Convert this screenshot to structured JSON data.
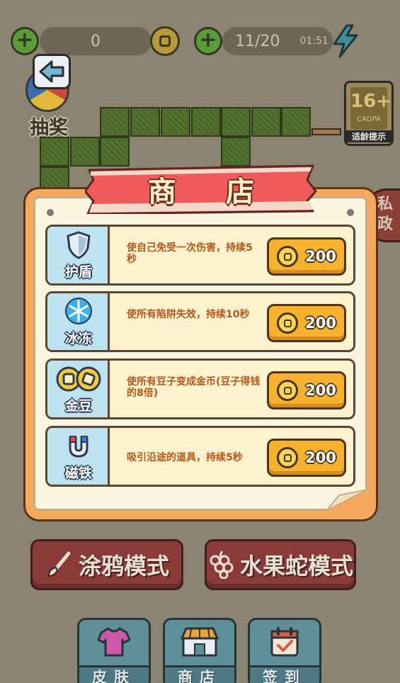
{
  "top_bar": {
    "score": "0",
    "progress": "11/20",
    "timer": "01:51"
  },
  "lottery": {
    "label": "抽奖"
  },
  "age_rating": {
    "label": "16+",
    "org": "CADPA",
    "hint": "适龄提示"
  },
  "side_tab": {
    "label": "私\n政"
  },
  "shop": {
    "title_1": "商",
    "title_2": "店",
    "items": [
      {
        "name": "护盾",
        "icon": "shield-icon",
        "desc": "使自己免受一次伤害，持续5秒",
        "price": "200"
      },
      {
        "name": "冰冻",
        "icon": "snowflake-icon",
        "desc": "使所有陷阱失效，持续10秒",
        "price": "200"
      },
      {
        "name": "金豆",
        "icon": "coins-icon",
        "desc": "使所有豆子变成金币(豆子得钱的8倍)",
        "price": "200"
      },
      {
        "name": "磁铁",
        "icon": "magnet-icon",
        "desc": "吸引沿途的道具，持续5秒",
        "price": "200"
      }
    ]
  },
  "modes": {
    "graffiti": "涂鸦模式",
    "fruit_snake": "水果蛇模式"
  },
  "nav": {
    "skin": "皮肤",
    "shop": "商店",
    "checkin": "签到"
  },
  "colors": {
    "dim_background": "#8c8470",
    "dialog_orange": "#f5a95c",
    "banner_red": "#ef5b5c",
    "buy_button": "#f6b22e",
    "description_text": "#b5561c"
  }
}
